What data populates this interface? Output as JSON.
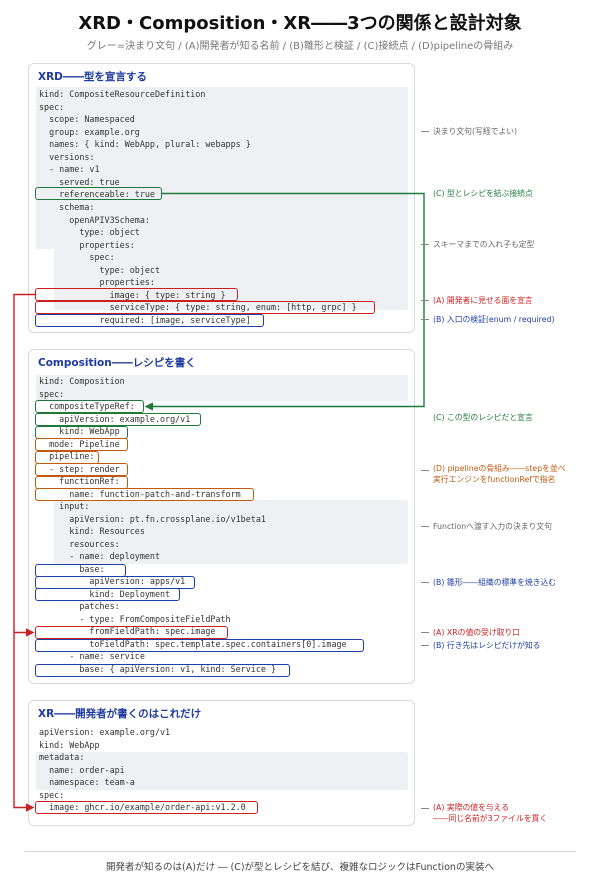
{
  "title": "XRD・Composition・XR――3つの関係と設計対象",
  "subtitle": "グレー=決まり文句 / (A)開発者が知る名前 / (B)雛形と検証 / (C)接続点 / (D)pipelineの骨組み",
  "panels": {
    "xrd": {
      "title": "XRD――型を宣言する",
      "lines": [
        "kind: CompositeResourceDefinition",
        "spec:",
        "  scope: Namespaced",
        "  group: example.org",
        "  names: { kind: WebApp, plural: webapps }",
        "  versions:",
        "  - name: v1",
        "    served: true",
        "    referenceable: true",
        "    schema:",
        "      openAPIV3Schema:",
        "        type: object",
        "        properties:",
        "          spec:",
        "            type: object",
        "            properties:",
        "              image: { type: string }",
        "              serviceType: { type: string, enum: [http, grpc] }",
        "            required: [image, serviceType]"
      ]
    },
    "composition": {
      "title": "Composition――レシピを書く",
      "lines": [
        "kind: Composition",
        "spec:",
        "  compositeTypeRef:",
        "    apiVersion: example.org/v1",
        "    kind: WebApp",
        "  mode: Pipeline",
        "  pipeline:",
        "  - step: render",
        "    functionRef:",
        "      name: function-patch-and-transform",
        "    input:",
        "      apiVersion: pt.fn.crossplane.io/v1beta1",
        "      kind: Resources",
        "      resources:",
        "      - name: deployment",
        "        base:",
        "          apiVersion: apps/v1",
        "          kind: Deployment",
        "        patches:",
        "        - type: FromCompositeFieldPath",
        "          fromFieldPath: spec.image",
        "          toFieldPath: spec.template.spec.containers[0].image",
        "      - name: service",
        "        base: { apiVersion: v1, kind: Service }"
      ]
    },
    "xr": {
      "title": "XR――開発者が書くのはこれだけ",
      "lines": [
        "apiVersion: example.org/v1",
        "kind: WebApp",
        "metadata:",
        "  name: order-api",
        "  namespace: team-a",
        "spec:",
        "  image: ghcr.io/example/order-api:v1.2.0"
      ]
    }
  },
  "annotations": {
    "boilerplate": "決まり文句(写経でよい)",
    "type_recipe_connect": "(C) 型とレシピを結ぶ接続点",
    "schema_nesting": "スキーマまでの入れ子も定型",
    "dev_facing": "(A) 開発者に見せる面を宣言",
    "validation": "(B) 入口の検証(enum / required)",
    "recipe_for_type": "(C) この型のレシピだと宣言",
    "pipeline_skeleton": "(D) pipelineの骨組み――stepを並べ\n実行エンジンをfunctionRefで指名",
    "function_input": "Functionへ渡す入力の決まり文句",
    "template_bake": "(B) 雛形――組織の標準を焼き込む",
    "receive_xr": "(A) XRの値の受け取り口",
    "destination": "(B) 行き先はレシピだけが知る",
    "actual_value": "(A) 実際の値を与える\n――同じ名前が3ファイルを貫く"
  },
  "footer": "開発者が知るのは(A)だけ ― (C)が型とレシピを結び、複雑なロジックはFunctionの実装へ",
  "colors": {
    "green": "#1f7a3a",
    "red": "#cc1f1f",
    "blue": "#1d3fa8",
    "orange": "#c05a10",
    "gray_bg": "#eef0f3",
    "panel_title": "#1e3a9e"
  }
}
